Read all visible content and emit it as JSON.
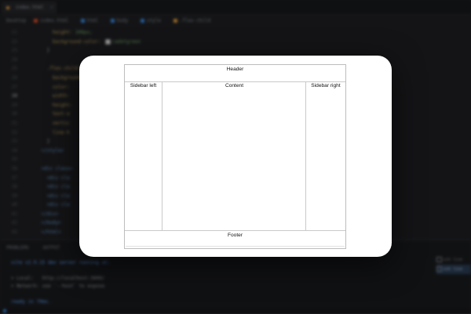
{
  "editor": {
    "tab": {
      "label": "index.html",
      "close": "×"
    },
    "breadcrumb": [
      "Desktop",
      "index.html",
      "html",
      "body",
      "style",
      ".flex-child"
    ],
    "line_numbers": [
      "21",
      "22",
      "23",
      "24",
      "25",
      "26",
      "27",
      "28",
      "29",
      "30",
      "31",
      "32",
      "33",
      "34",
      "35",
      "36",
      "37",
      "38",
      "39",
      "40",
      "41",
      "42",
      "43"
    ],
    "current_line": "28",
    "code_lines": [
      {
        "prop": "height:",
        "val": "200px;"
      },
      {
        "prop": "background-color:",
        "val": "cadetgreen"
      },
      {
        "plain": "}"
      },
      {
        "plain": ""
      },
      {
        "sel": ".flex-child {"
      },
      {
        "prop": "background",
        "val": ""
      },
      {
        "prop": "color:",
        "val": ""
      },
      {
        "prop": "width:",
        "val": ""
      },
      {
        "prop": "height:",
        "val": ""
      },
      {
        "prop": "text-a",
        "val": ""
      },
      {
        "prop": "vertic",
        "val": ""
      },
      {
        "prop": "line-h",
        "val": ""
      },
      {
        "plain": "}"
      },
      {
        "tag": "</style>"
      },
      {
        "plain": ""
      },
      {
        "tag": "<div class="
      },
      {
        "tag": "  <div cla"
      },
      {
        "tag": "  <div cla"
      },
      {
        "tag": "  <div cla"
      },
      {
        "tag": "  <div cla"
      },
      {
        "tag": "</div>"
      },
      {
        "tag": "</body>"
      },
      {
        "tag": "</html>"
      }
    ],
    "panel_tabs": [
      "PROBLEMS",
      "OUTPUT"
    ],
    "terminal": [
      "vite v2.9.15 dev server running at:",
      "",
      "> Local:   http://localhost:3000/",
      "> Network: use `--host` to expose",
      "",
      "ready in 79ms."
    ],
    "right_panel": [
      "zsh  live",
      "zsh  live"
    ]
  },
  "preview": {
    "header": "Header",
    "sidebar_left": "Sidebar left",
    "content": "Content",
    "sidebar_right": "Sidebar right",
    "footer": "Footer"
  },
  "colors": {
    "editor_bg": "#1f2023",
    "modal_bg": "#ffffff",
    "border": "#c9c9c9"
  }
}
